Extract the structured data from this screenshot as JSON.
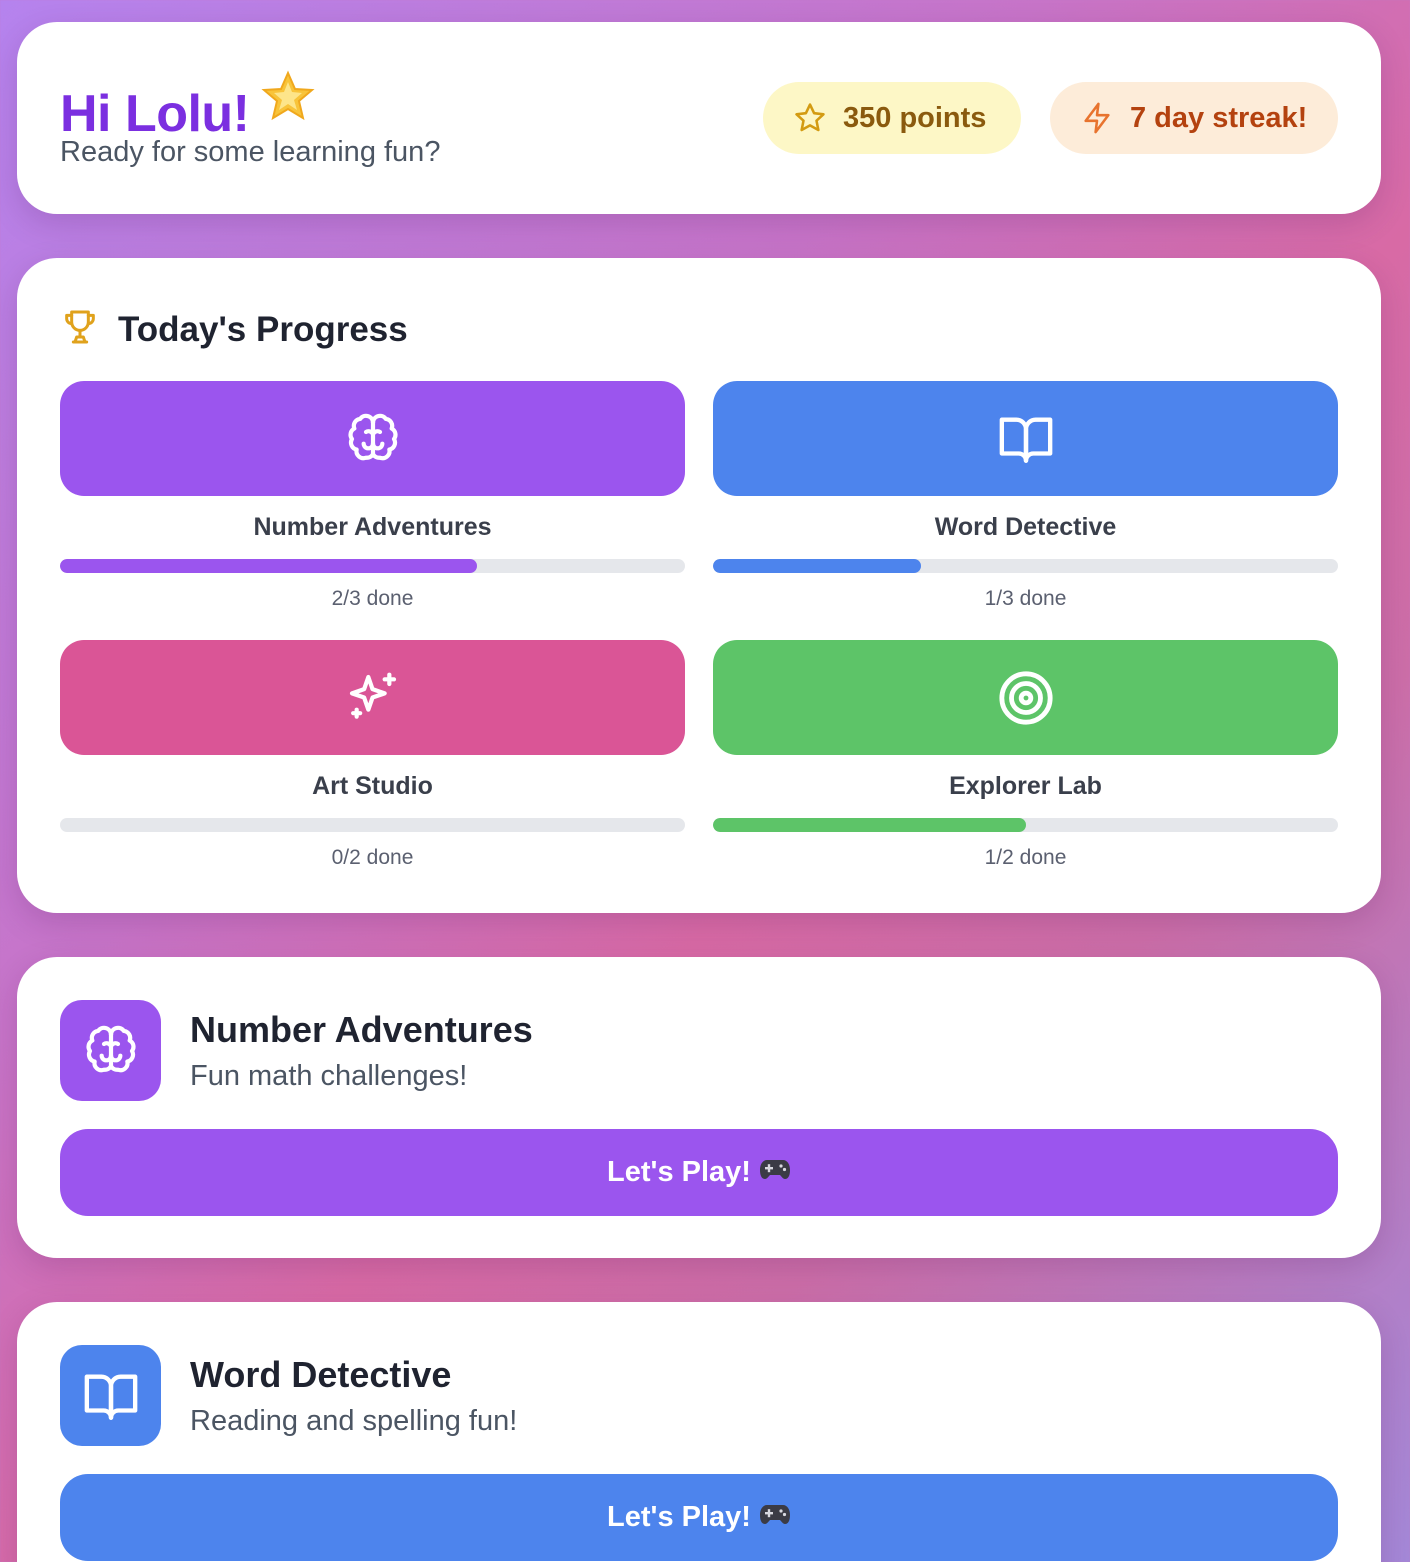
{
  "header": {
    "greeting": "Hi Lolu!",
    "subtitle": "Ready for some learning fun?",
    "points_label": "350 points",
    "streak_label": "7 day streak!"
  },
  "progress": {
    "title": "Today's Progress",
    "tiles": [
      {
        "name": "Number Adventures",
        "icon": "brain-icon",
        "color": "#9b55ee",
        "done": 2,
        "total": 3,
        "done_label": "2/3 done"
      },
      {
        "name": "Word Detective",
        "icon": "book-icon",
        "color": "#4d84ed",
        "done": 1,
        "total": 3,
        "done_label": "1/3 done"
      },
      {
        "name": "Art Studio",
        "icon": "sparkles-icon",
        "color": "#da5596",
        "done": 0,
        "total": 2,
        "done_label": "0/2 done"
      },
      {
        "name": "Explorer Lab",
        "icon": "target-icon",
        "color": "#5dc468",
        "done": 1,
        "total": 2,
        "done_label": "1/2 done"
      }
    ]
  },
  "activities": [
    {
      "title": "Number Adventures",
      "description": "Fun math challenges!",
      "button_label": "Let's Play!",
      "icon": "brain-icon",
      "color": "#9b55ee"
    },
    {
      "title": "Word Detective",
      "description": "Reading and spelling fun!",
      "button_label": "Let's Play!",
      "icon": "book-icon",
      "color": "#4d84ed"
    }
  ]
}
